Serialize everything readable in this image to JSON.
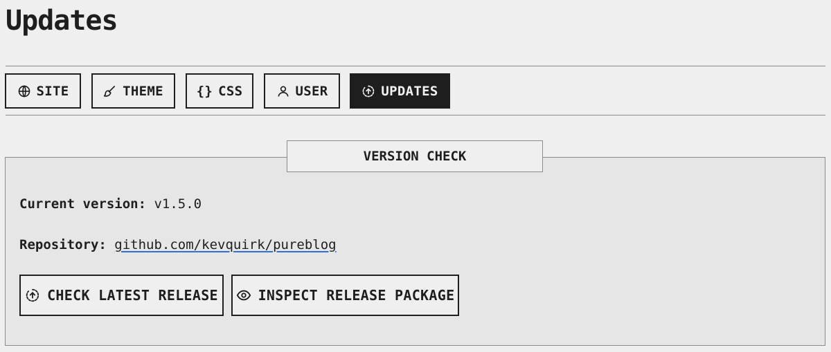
{
  "page": {
    "title": "Updates"
  },
  "tabs": [
    {
      "label": "SITE",
      "icon": "globe-icon",
      "active": false
    },
    {
      "label": "THEME",
      "icon": "brush-icon",
      "active": false
    },
    {
      "label": "CSS",
      "icon": "braces-icon",
      "glyph": "{}",
      "active": false
    },
    {
      "label": "USER",
      "icon": "user-icon",
      "active": false
    },
    {
      "label": "UPDATES",
      "icon": "update-icon",
      "active": true
    }
  ],
  "version_check": {
    "legend": "VERSION CHECK",
    "current_version_label": "Current version:",
    "current_version_value": "v1.5.0",
    "repository_label": "Repository:",
    "repository_value": "github.com/kevquirk/pureblog",
    "check_button": {
      "label": "CHECK LATEST RELEASE",
      "icon": "update-icon"
    },
    "inspect_button": {
      "label": "INSPECT RELEASE PACKAGE",
      "icon": "eye-icon"
    }
  },
  "colors": {
    "background": "#efefef",
    "panel": "#e6e6e6",
    "text": "#1e1e1e",
    "active_tab": "#1e1e1e",
    "link_underline": "#2f6fd6"
  }
}
